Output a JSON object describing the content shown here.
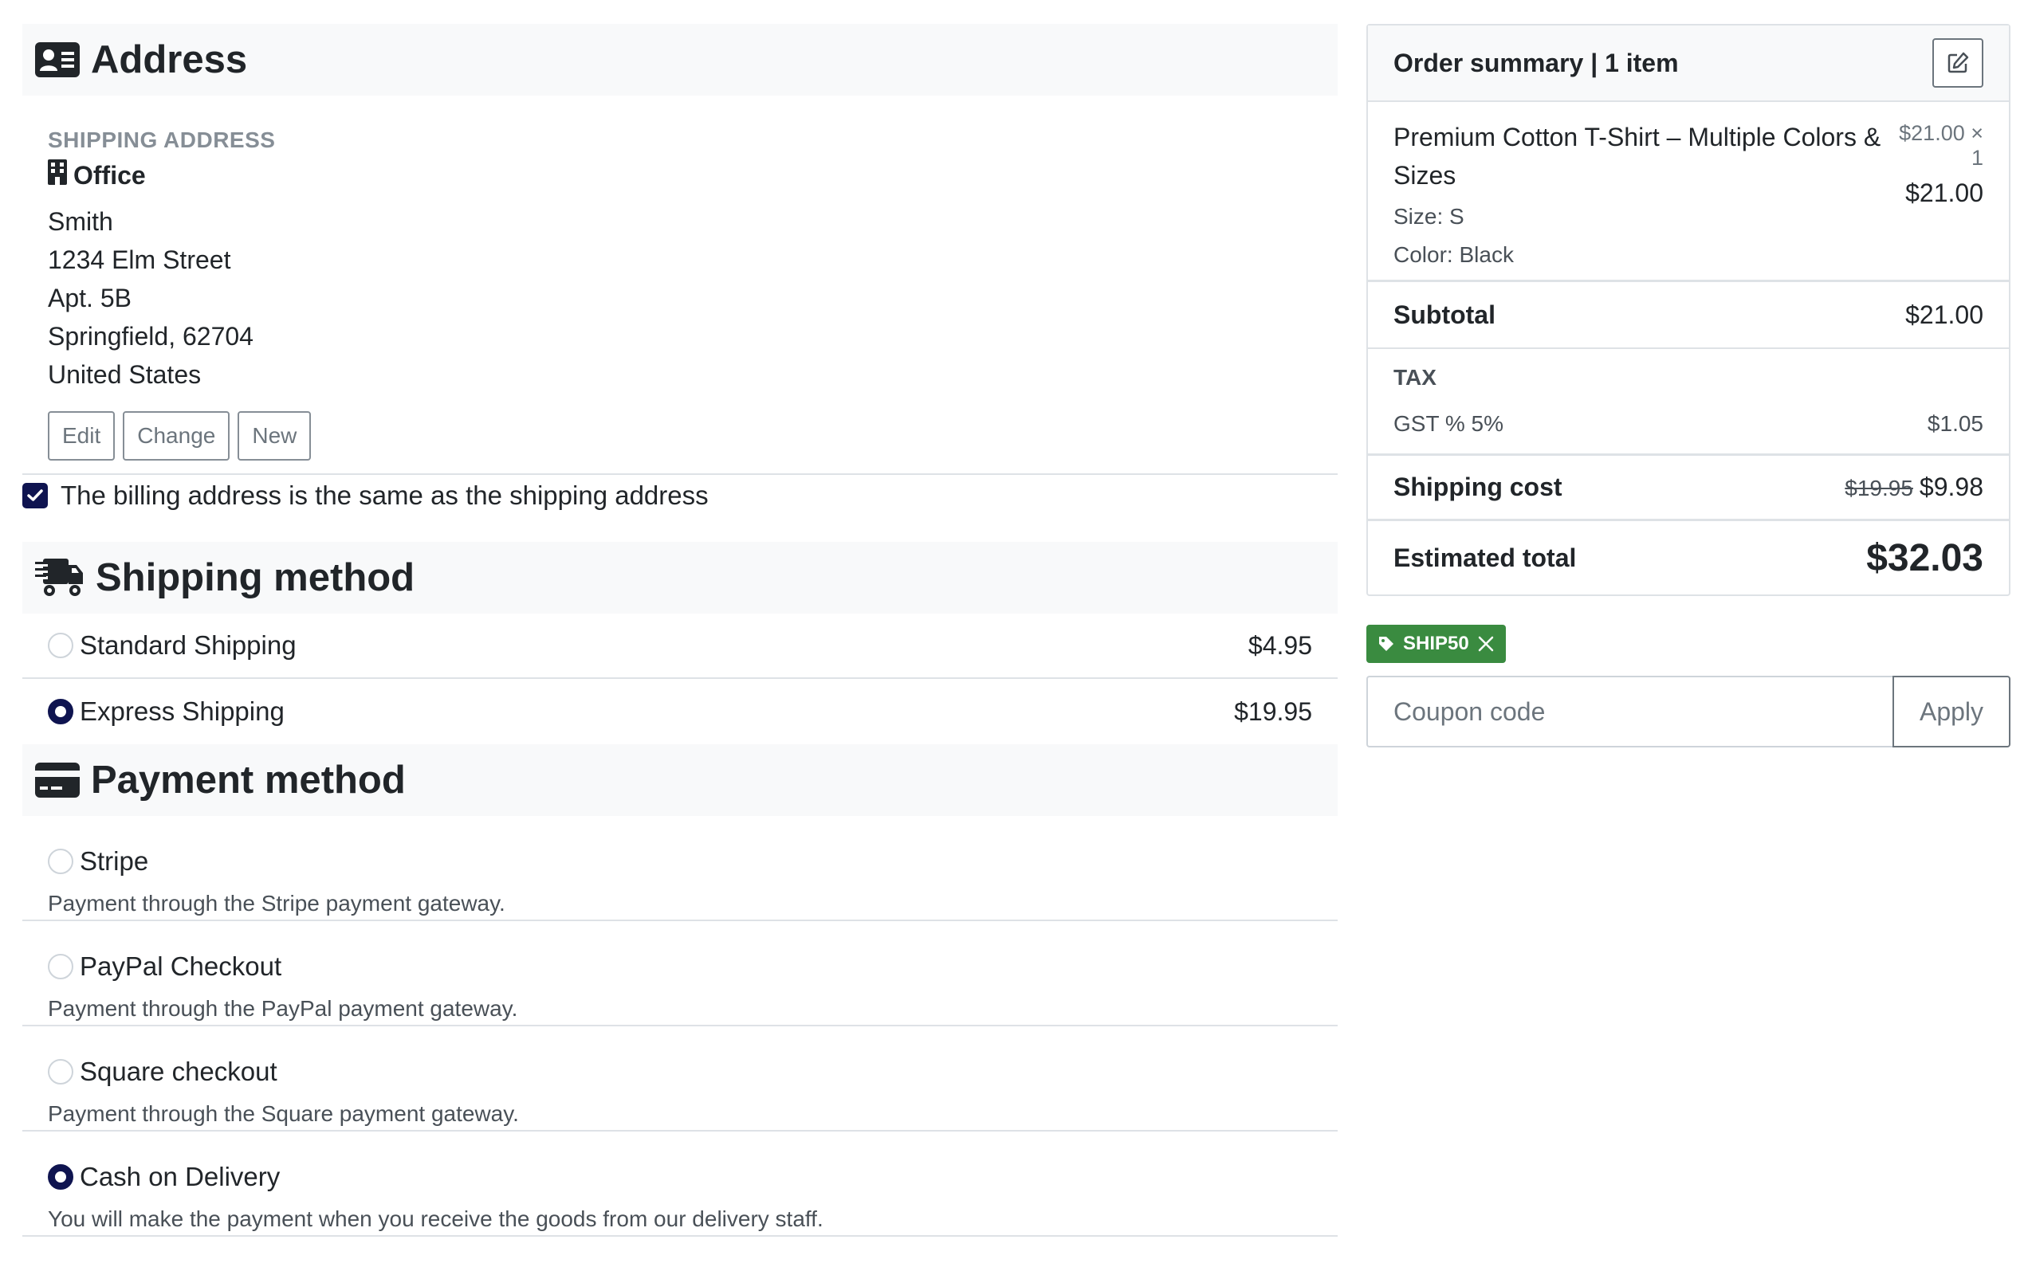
{
  "address_section": {
    "title": "Address",
    "shipping_label": "SHIPPING ADDRESS",
    "type": "Office",
    "lines": [
      "Smith",
      "1234 Elm Street",
      "Apt. 5B",
      "Springfield, 62704",
      "United States"
    ],
    "buttons": {
      "edit": "Edit",
      "change": "Change",
      "new": "New"
    },
    "billing_same_label": "The billing address is the same as the shipping address",
    "billing_same_checked": true
  },
  "shipping_section": {
    "title": "Shipping method",
    "options": [
      {
        "label": "Standard Shipping",
        "price": "$4.95",
        "selected": false
      },
      {
        "label": "Express Shipping",
        "price": "$19.95",
        "selected": true
      }
    ]
  },
  "payment_section": {
    "title": "Payment method",
    "options": [
      {
        "label": "Stripe",
        "description": "Payment through the Stripe payment gateway.",
        "selected": false
      },
      {
        "label": "PayPal Checkout",
        "description": "Payment through the PayPal payment gateway.",
        "selected": false
      },
      {
        "label": "Square checkout",
        "description": "Payment through the Square payment gateway.",
        "selected": false
      },
      {
        "label": "Cash on Delivery",
        "description": "You will make the payment when you receive the goods from our delivery staff.",
        "selected": true
      }
    ]
  },
  "order_summary": {
    "title": "Order summary | 1 item",
    "item": {
      "name": "Premium Cotton T-Shirt – Multiple Colors & Sizes",
      "size": "Size: S",
      "color": "Color: Black",
      "unit_price": "$21.00 × 1",
      "line_total": "$21.00"
    },
    "subtotal_label": "Subtotal",
    "subtotal_value": "$21.00",
    "tax_label": "TAX",
    "tax_name": "GST % 5%",
    "tax_value": "$1.05",
    "shipping_label": "Shipping cost",
    "shipping_original": "$19.95",
    "shipping_value": "$9.98",
    "total_label": "Estimated total",
    "total_value": "$32.03"
  },
  "coupon": {
    "applied_code": "SHIP50",
    "placeholder": "Coupon code",
    "apply_label": "Apply"
  },
  "colors": {
    "accent": "#0f1450",
    "coupon_tag": "#3a8b40",
    "section_bg": "#f8f9fa"
  }
}
